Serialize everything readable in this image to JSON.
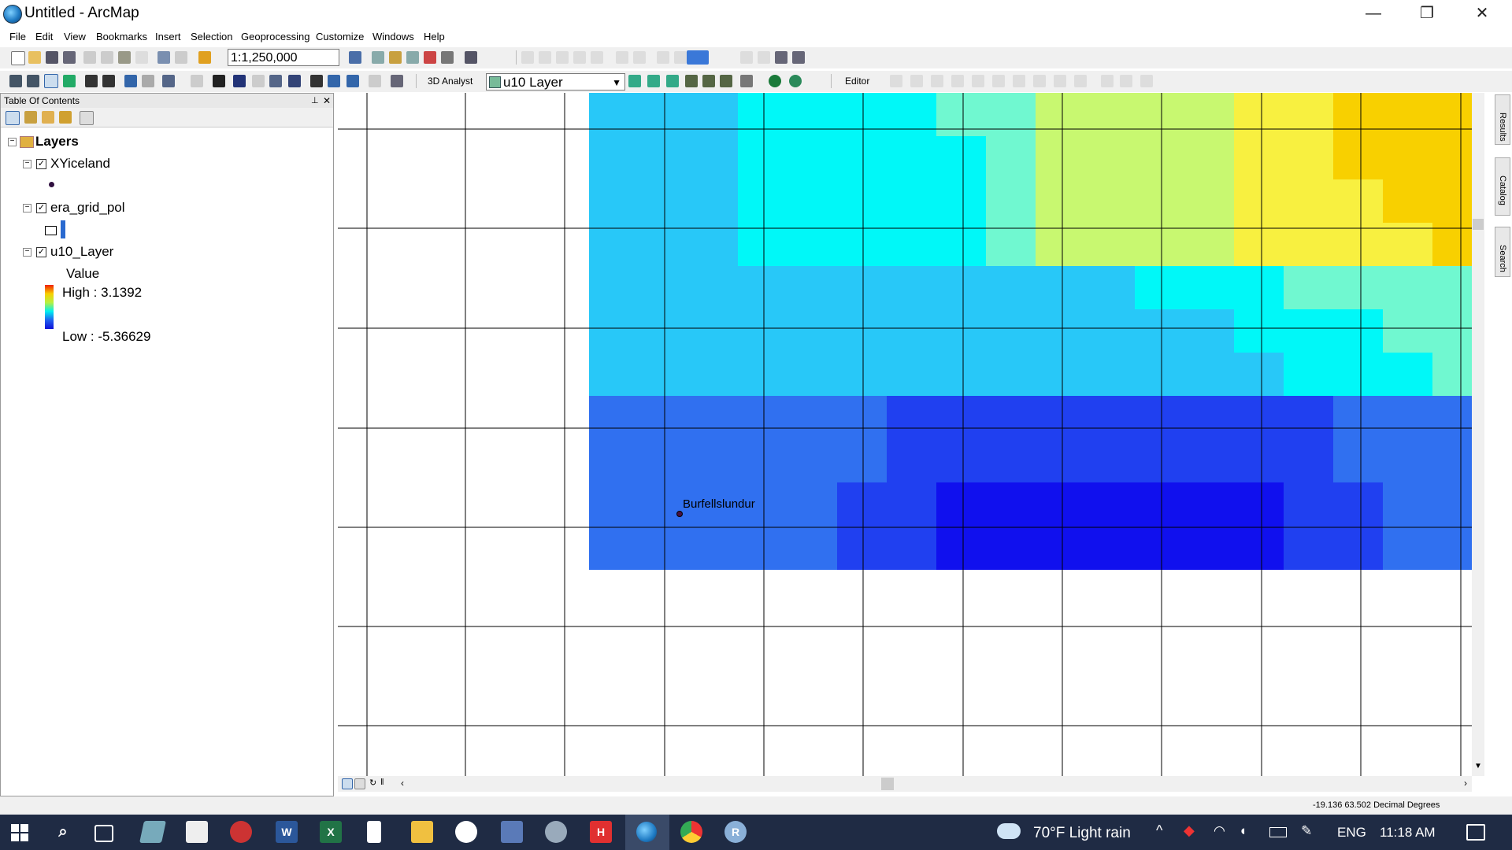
{
  "window": {
    "title": "Untitled - ArcMap",
    "controls": [
      "—",
      "❐",
      "✕"
    ]
  },
  "menu": [
    "File",
    "Edit",
    "View",
    "Bookmarks",
    "Insert",
    "Selection",
    "Geoprocessing",
    "Customize",
    "Windows",
    "Help"
  ],
  "toolbar": {
    "scale": "1:1,250,000",
    "analyst_label": "3D Analyst",
    "layer_select": "u10 Layer",
    "editor_label": "Editor"
  },
  "toc": {
    "header": "Table Of Contents",
    "root": "Layers",
    "layers": [
      {
        "name": "XYiceland"
      },
      {
        "name": "era_grid_pol"
      },
      {
        "name": "u10_Layer"
      }
    ],
    "legend": {
      "title": "Value",
      "high": "High : 3.1392",
      "low": "Low : -5.36629"
    }
  },
  "map": {
    "point_label": "Burfellslundur"
  },
  "side_tabs": [
    "Results",
    "Catalog",
    "Search"
  ],
  "status": {
    "coords": "-19.136  63.502 Decimal Degrees"
  },
  "taskbar": {
    "weather": "70°F  Light rain",
    "lang": "ENG",
    "time": "11:18 AM"
  },
  "colors": {
    "ramp": [
      "#1010ee",
      "#2040f0",
      "#3070f0",
      "#28c8f8",
      "#00f8f8",
      "#70f8d0",
      "#c8f870",
      "#f8f040",
      "#f8d000",
      "#f8b000"
    ],
    "taskbar_bg": "#1f2b44"
  },
  "raster": [
    [
      3,
      3,
      3,
      4,
      4,
      4,
      4,
      5,
      5,
      6,
      6,
      6,
      6,
      7,
      7,
      8,
      8,
      8,
      8,
      9,
      9,
      9
    ],
    [
      3,
      3,
      3,
      4,
      4,
      4,
      4,
      4,
      5,
      6,
      6,
      6,
      6,
      7,
      7,
      8,
      8,
      8,
      8,
      9,
      9,
      9
    ],
    [
      3,
      3,
      3,
      4,
      4,
      4,
      4,
      4,
      5,
      6,
      6,
      6,
      6,
      7,
      7,
      7,
      8,
      8,
      8,
      8,
      8,
      8
    ],
    [
      3,
      3,
      3,
      4,
      4,
      4,
      4,
      4,
      5,
      6,
      6,
      6,
      6,
      7,
      7,
      7,
      7,
      8,
      8,
      8,
      8,
      8
    ],
    [
      3,
      3,
      3,
      3,
      3,
      3,
      3,
      3,
      3,
      3,
      3,
      4,
      4,
      4,
      5,
      5,
      5,
      5,
      6,
      6,
      6,
      6
    ],
    [
      3,
      3,
      3,
      3,
      3,
      3,
      3,
      3,
      3,
      3,
      3,
      3,
      3,
      4,
      4,
      4,
      5,
      5,
      5,
      5,
      6,
      6
    ],
    [
      3,
      3,
      3,
      3,
      3,
      3,
      3,
      3,
      3,
      3,
      3,
      3,
      3,
      3,
      4,
      4,
      4,
      5,
      5,
      5,
      6,
      6
    ],
    [
      2,
      2,
      2,
      2,
      2,
      2,
      1,
      1,
      1,
      1,
      1,
      1,
      1,
      1,
      1,
      2,
      2,
      2,
      2,
      3,
      3,
      4
    ],
    [
      2,
      2,
      2,
      2,
      2,
      2,
      1,
      1,
      1,
      1,
      1,
      1,
      1,
      1,
      1,
      2,
      2,
      2,
      2,
      3,
      3,
      4
    ],
    [
      2,
      2,
      2,
      2,
      2,
      1,
      1,
      0,
      0,
      0,
      0,
      0,
      0,
      0,
      1,
      1,
      2,
      2,
      2,
      3,
      3,
      4
    ],
    [
      2,
      2,
      2,
      2,
      2,
      1,
      1,
      0,
      0,
      0,
      0,
      0,
      0,
      0,
      1,
      1,
      2,
      2,
      2,
      3,
      3,
      4
    ]
  ]
}
